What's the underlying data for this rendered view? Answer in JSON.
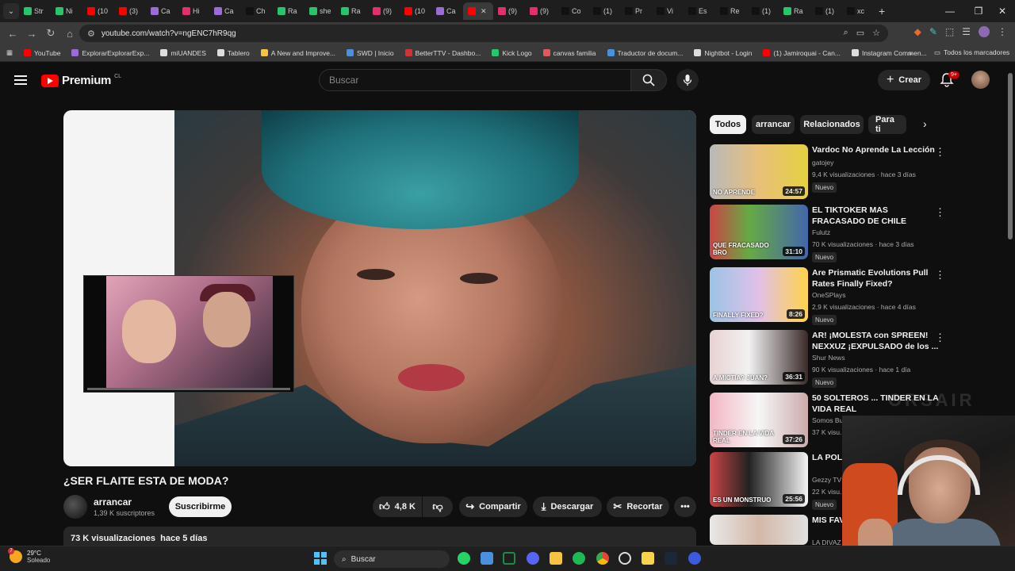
{
  "browser": {
    "tabs": [
      "Str",
      "Ni",
      "(10",
      "(3)",
      "Ca",
      "Hi",
      "Ca",
      "Ch",
      "Ra",
      "she",
      "Ra",
      "(9)",
      "(10",
      "Ca",
      "",
      "(9)",
      "(9)",
      "Co",
      "(1)",
      "Pr",
      "Vi",
      "Es",
      "Re",
      "(1)",
      "Ra",
      "(1)",
      "xc"
    ],
    "url": "youtube.com/watch?v=ngENC7hR9qg",
    "bookmarks": [
      "YouTube",
      "ExplorarExplorarExp...",
      "miUANDES",
      "Tablero",
      "A New and Improve...",
      "SWD | Inicio",
      "BetterTTV - Dashbo...",
      "Kick Logo",
      "canvas familia",
      "Traductor de docum...",
      "Nightbot - Login",
      "(1) Jamiroquai - Can...",
      "Instagram Commen..."
    ],
    "bookmarks_all": "Todos los marcadores"
  },
  "yt": {
    "logo_text": "Premium",
    "country": "CL",
    "search_placeholder": "Buscar",
    "create_label": "Crear",
    "notif_badge": "9+"
  },
  "video": {
    "title": "¿SER FLAITE ESTA DE MODA?",
    "channel": "arrancar",
    "subscribers": "1,39 K suscriptores",
    "subscribe_label": "Suscribirme",
    "likes": "4,8 K",
    "share_label": "Compartir",
    "download_label": "Descargar",
    "clip_label": "Recortar",
    "views": "73 K visualizaciones",
    "date": "hace 5 días"
  },
  "chips": [
    "Todos",
    "arrancar",
    "Relacionados",
    "Para ti"
  ],
  "recommendations": [
    {
      "title": "Vardoc No Aprende La Lección",
      "channel": "gatojey",
      "meta": "9,4 K visualizaciones · hace 3 días",
      "badge": "Nuevo",
      "duration": "24:57",
      "thumb_text": "NO APRENDE"
    },
    {
      "title": "EL TIKTOKER MAS FRACASADO DE CHILE",
      "channel": "Fulutz",
      "meta": "70 K visualizaciones · hace 3 días",
      "badge": "Nuevo",
      "duration": "31:10",
      "thumb_text": "QUE FRACASADO BRO"
    },
    {
      "title": "Are Prismatic Evolutions Pull Rates Finally Fixed?",
      "channel": "OneSPlays",
      "meta": "2,9 K visualizaciones · hace 4 días",
      "badge": "Nuevo",
      "duration": "8:26",
      "thumb_text": "FINALLY FIXED?"
    },
    {
      "title": "AR! ¡MOLESTA con SPREEN! NEXXUZ ¡EXPULSADO de los ...",
      "channel": "Shur News",
      "meta": "90 K visualizaciones · hace 1 día",
      "badge": "Nuevo",
      "duration": "36:31",
      "thumb_text": "A MICTIA? JUAN?"
    },
    {
      "title": "50 SOLTEROS ... TINDER EN LA VIDA REAL",
      "channel": "Somos Bu...",
      "meta": "37 K visu...",
      "badge": "",
      "duration": "37:26",
      "thumb_text": "TINDER EN LA VIDA REAL"
    },
    {
      "title": "LA POLI... por LA M...",
      "channel": "Gezzy TV",
      "meta": "22 K visu...",
      "badge": "Nuevo",
      "duration": "25:56",
      "thumb_text": "ES UN MONSTRUO"
    },
    {
      "title": "MIS FAV... UNIVERS...",
      "channel": "LA DIVAZ",
      "meta": "",
      "badge": "",
      "duration": "",
      "thumb_text": ""
    }
  ],
  "overlay": {
    "watermark": "ORSAIR"
  },
  "taskbar": {
    "temp": "29°C",
    "weather": "Soleado",
    "weather_badge": "7",
    "search_label": "Buscar"
  }
}
